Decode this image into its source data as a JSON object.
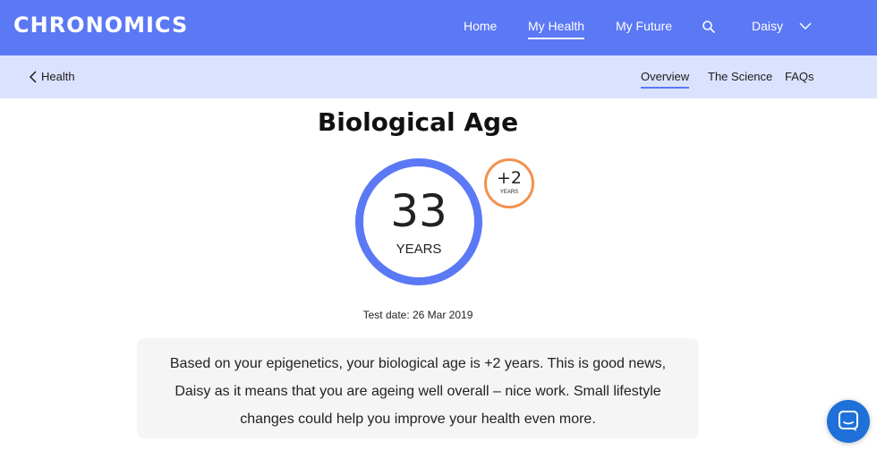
{
  "brand": {
    "name": "CHRONOMICS"
  },
  "top_nav": {
    "items": [
      {
        "label": "Home"
      },
      {
        "label": "My Health",
        "active": true
      },
      {
        "label": "My Future"
      }
    ],
    "search_icon": "search-icon",
    "user_name": "Daisy",
    "dropdown_icon": "chevron-down-icon"
  },
  "sub_nav": {
    "back_label": "Health",
    "back_icon": "chevron-left-icon",
    "tabs": [
      {
        "label": "Overview",
        "active": true
      },
      {
        "label": "The Science"
      },
      {
        "label": "FAQs"
      }
    ]
  },
  "main": {
    "title": "Biological Age",
    "age_value": "33",
    "age_unit": "YEARS",
    "difference_value": "+2",
    "difference_unit": "YEARS",
    "test_date": "Test date: 26 Mar 2019",
    "summary": "Based on your epigenetics, your biological age is +2 years. This is good news, Daisy as it means that you are ageing well overall – nice work. Small lifestyle changes could help you improve your health even more."
  },
  "chat": {
    "icon": "chat-icon"
  },
  "colors": {
    "primary": "#5b78f5",
    "subnav_bg": "#dbe2fd",
    "accent_orange": "#f3914f",
    "chat_blue": "#1f70d8",
    "card_bg": "#f5f5f6"
  }
}
